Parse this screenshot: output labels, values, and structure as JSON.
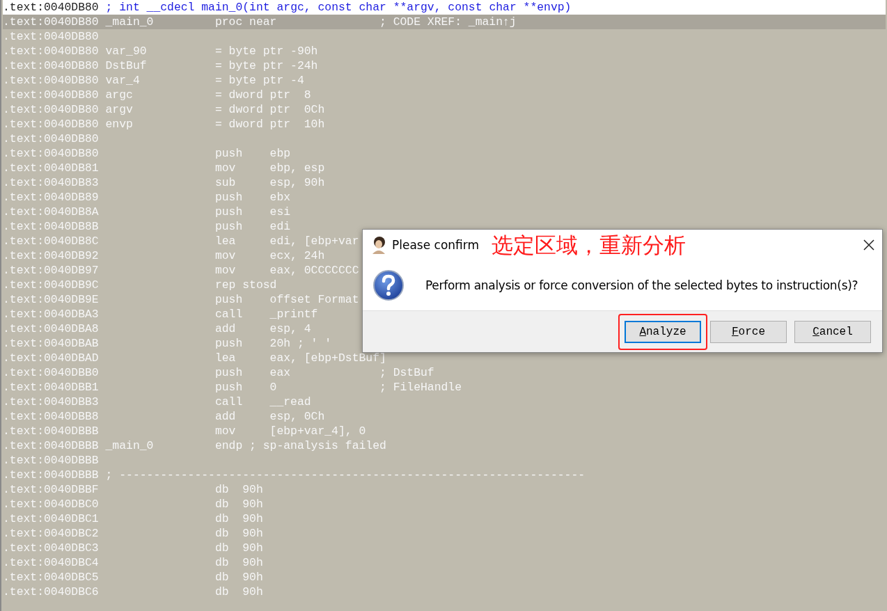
{
  "listing": {
    "lines": [
      {
        "kind": "header",
        "address": ".text:0040DB80",
        "comment": "; int __cdecl main_0(int argc, const char **argv, const char **envp)"
      },
      {
        "kind": "code",
        "address": ".text:0040DB80",
        "label": "_main_0",
        "mnemonic": "proc near",
        "comment": "; CODE XREF: _main↑j",
        "selected": true
      },
      {
        "kind": "code",
        "address": ".text:0040DB80",
        "selected": false
      },
      {
        "kind": "code",
        "address": ".text:0040DB80",
        "label": "var_90",
        "mnemonic": "= byte ptr -90h",
        "selected": false
      },
      {
        "kind": "code",
        "address": ".text:0040DB80",
        "label": "DstBuf",
        "mnemonic": "= byte ptr -24h",
        "selected": false
      },
      {
        "kind": "code",
        "address": ".text:0040DB80",
        "label": "var_4",
        "mnemonic": "= byte ptr -4",
        "selected": false
      },
      {
        "kind": "code",
        "address": ".text:0040DB80",
        "label": "argc",
        "mnemonic": "= dword ptr  8",
        "selected": false
      },
      {
        "kind": "code",
        "address": ".text:0040DB80",
        "label": "argv",
        "mnemonic": "= dword ptr  0Ch",
        "selected": false
      },
      {
        "kind": "code",
        "address": ".text:0040DB80",
        "label": "envp",
        "mnemonic": "= dword ptr  10h",
        "selected": false
      },
      {
        "kind": "code",
        "address": ".text:0040DB80",
        "selected": false
      },
      {
        "kind": "code",
        "address": ".text:0040DB80",
        "mnemonic": "push",
        "operands": "ebp",
        "selected": false
      },
      {
        "kind": "code",
        "address": ".text:0040DB81",
        "mnemonic": "mov",
        "operands": "ebp, esp",
        "selected": false
      },
      {
        "kind": "code",
        "address": ".text:0040DB83",
        "mnemonic": "sub",
        "operands": "esp, 90h",
        "selected": false
      },
      {
        "kind": "code",
        "address": ".text:0040DB89",
        "mnemonic": "push",
        "operands": "ebx",
        "selected": false
      },
      {
        "kind": "code",
        "address": ".text:0040DB8A",
        "mnemonic": "push",
        "operands": "esi",
        "selected": false
      },
      {
        "kind": "code",
        "address": ".text:0040DB8B",
        "mnemonic": "push",
        "operands": "edi",
        "selected": false
      },
      {
        "kind": "code",
        "address": ".text:0040DB8C",
        "mnemonic": "lea",
        "operands": "edi, [ebp+var",
        "selected": false
      },
      {
        "kind": "code",
        "address": ".text:0040DB92",
        "mnemonic": "mov",
        "operands": "ecx, 24h",
        "selected": false
      },
      {
        "kind": "code",
        "address": ".text:0040DB97",
        "mnemonic": "mov",
        "operands": "eax, 0CCCCCCC",
        "selected": false
      },
      {
        "kind": "code",
        "address": ".text:0040DB9C",
        "mnemonic": "rep stosd",
        "selected": false
      },
      {
        "kind": "code",
        "address": ".text:0040DB9E",
        "mnemonic": "push",
        "operands": "offset Format",
        "selected": false
      },
      {
        "kind": "code",
        "address": ".text:0040DBA3",
        "mnemonic": "call",
        "operands": "_printf",
        "selected": false
      },
      {
        "kind": "code",
        "address": ".text:0040DBA8",
        "mnemonic": "add",
        "operands": "esp, 4",
        "selected": false
      },
      {
        "kind": "code",
        "address": ".text:0040DBAB",
        "mnemonic": "push",
        "operands": "20h ; ' '",
        "selected": false
      },
      {
        "kind": "code",
        "address": ".text:0040DBAD",
        "mnemonic": "lea",
        "operands": "eax, [ebp+DstBuf]",
        "selected": false
      },
      {
        "kind": "code",
        "address": ".text:0040DBB0",
        "mnemonic": "push",
        "operands": "eax",
        "comment": "; DstBuf",
        "selected": false
      },
      {
        "kind": "code",
        "address": ".text:0040DBB1",
        "mnemonic": "push",
        "operands": "0",
        "comment": "; FileHandle",
        "selected": false
      },
      {
        "kind": "code",
        "address": ".text:0040DBB3",
        "mnemonic": "call",
        "operands": "__read",
        "selected": false
      },
      {
        "kind": "code",
        "address": ".text:0040DBB8",
        "mnemonic": "add",
        "operands": "esp, 0Ch",
        "selected": false
      },
      {
        "kind": "code",
        "address": ".text:0040DBBB",
        "mnemonic": "mov",
        "operands": "[ebp+var_4], 0",
        "selected": false
      },
      {
        "kind": "code",
        "address": ".text:0040DBBB",
        "label": "_main_0",
        "mnemonic": "endp ; sp-analysis failed",
        "selected": false
      },
      {
        "kind": "code",
        "address": ".text:0040DBBB",
        "selected": false
      },
      {
        "kind": "separator",
        "address": ".text:0040DBBB",
        "comment": "; --------------------------------------------------------------------",
        "selected": false
      },
      {
        "kind": "code",
        "address": ".text:0040DBBF",
        "mnemonic": "db  90h",
        "selected": false
      },
      {
        "kind": "code",
        "address": ".text:0040DBC0",
        "mnemonic": "db  90h",
        "selected": false
      },
      {
        "kind": "code",
        "address": ".text:0040DBC1",
        "mnemonic": "db  90h",
        "selected": false
      },
      {
        "kind": "code",
        "address": ".text:0040DBC2",
        "mnemonic": "db  90h",
        "selected": false
      },
      {
        "kind": "code",
        "address": ".text:0040DBC3",
        "mnemonic": "db  90h",
        "selected": false
      },
      {
        "kind": "code",
        "address": ".text:0040DBC4",
        "mnemonic": "db  90h",
        "selected": false
      },
      {
        "kind": "code",
        "address": ".text:0040DBC5",
        "mnemonic": "db  90h",
        "selected": false
      },
      {
        "kind": "code",
        "address": ".text:0040DBC6",
        "mnemonic": "db  90h",
        "selected": false
      }
    ]
  },
  "dialog": {
    "title": "Please confirm",
    "annotation": "选定区域，重新分析",
    "message": "Perform analysis or force conversion of the selected bytes to instruction(s)?",
    "buttons": [
      {
        "label": "Analyze",
        "focused": true,
        "highlighted": true
      },
      {
        "label": "Force",
        "focused": false,
        "highlighted": false
      },
      {
        "label": "Cancel",
        "focused": false,
        "highlighted": false
      }
    ]
  }
}
